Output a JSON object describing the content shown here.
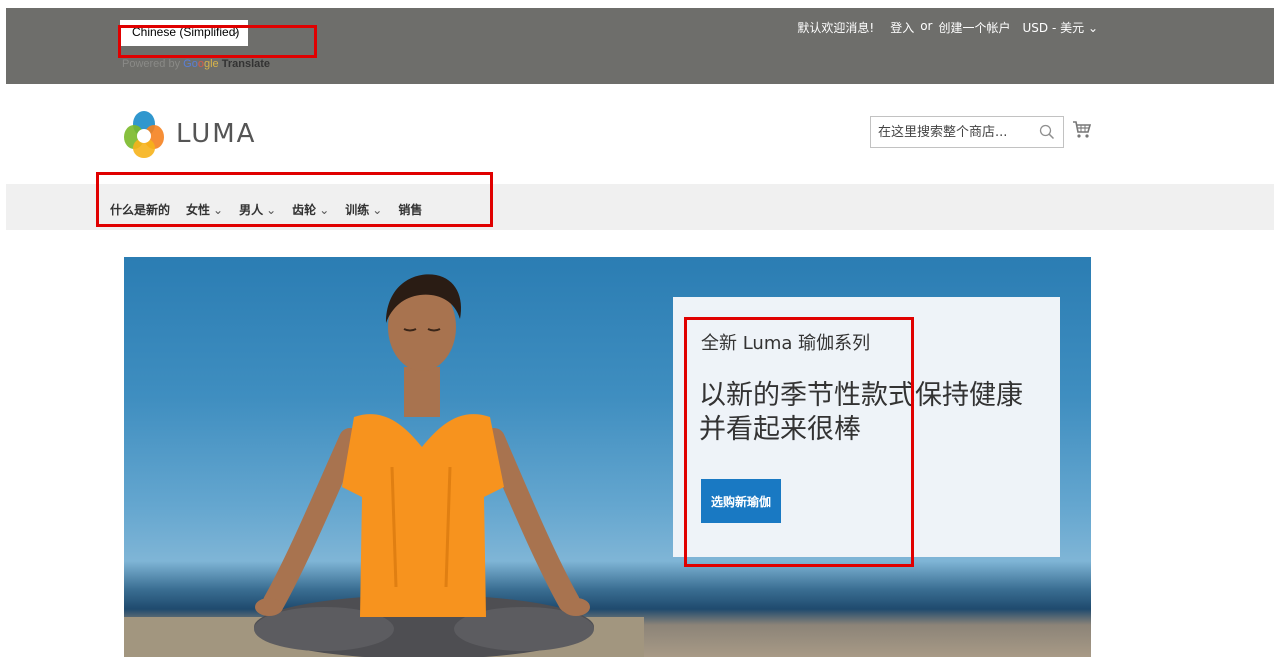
{
  "header": {
    "language": "Chinese (Simplified)",
    "powered_by": "Powered by",
    "google_g1": "Go",
    "google_g2": "o",
    "google_g3": "gle",
    "translate": "Translate",
    "welcome": "默认欢迎消息!",
    "sign_in": "登入",
    "or": "or",
    "create_account": "创建一个帐户",
    "currency": "USD - 美元"
  },
  "logo": {
    "text": "LUMA"
  },
  "search": {
    "placeholder": "在这里搜索整个商店..."
  },
  "nav": {
    "items": [
      {
        "label": "什么是新的",
        "has_dropdown": false
      },
      {
        "label": "女性",
        "has_dropdown": true
      },
      {
        "label": "男人",
        "has_dropdown": true
      },
      {
        "label": "齿轮",
        "has_dropdown": true
      },
      {
        "label": "训练",
        "has_dropdown": true
      },
      {
        "label": "销售",
        "has_dropdown": false
      }
    ]
  },
  "hero": {
    "kicker": "全新 Luma 瑜伽系列",
    "headline": "以新的季节性款式保持健康并看起来很棒",
    "cta_label": "选购新瑜伽"
  },
  "colors": {
    "top_bar": "#6e6e6b",
    "nav_bg": "#f0f0f0",
    "cta": "#1979c3",
    "annotation": "#e00000"
  },
  "icons": {
    "search": "search-icon",
    "cart": "cart-icon",
    "dropdown": "chevron-down-icon"
  }
}
